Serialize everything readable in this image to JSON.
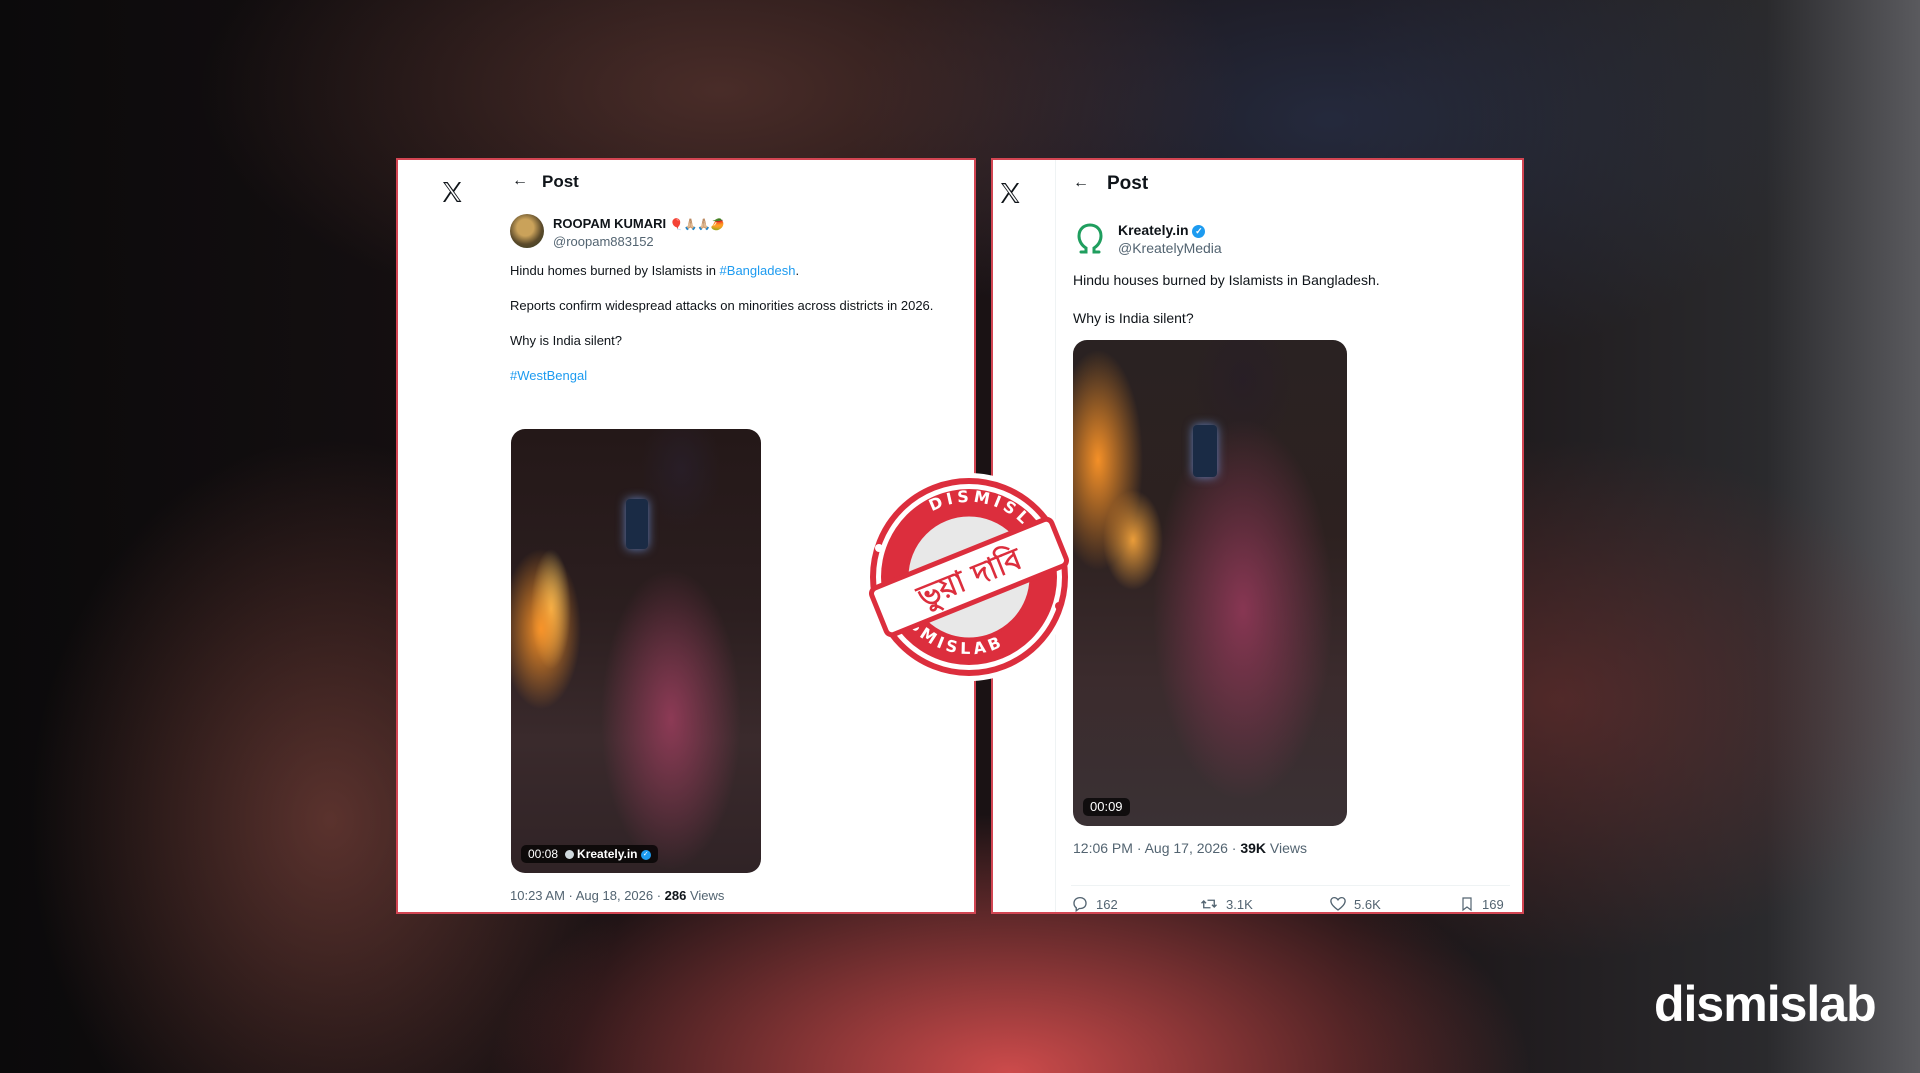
{
  "left_post": {
    "header_title": "Post",
    "author_name": "ROOPAM KUMARI",
    "author_emojis": "🎈🙏🏼🙏🏼🥭",
    "author_handle": "@roopam883152",
    "line1_prefix": "Hindu homes burned by Islamists in ",
    "line1_hashtag": "#Bangladesh",
    "line1_suffix": ".",
    "line2": "Reports confirm widespread attacks on minorities across districts in 2026.",
    "line3": "Why is India silent?",
    "hashtag2": "#WestBengal",
    "video_time": "00:08",
    "video_source": "Kreately.in",
    "timestamp": "10:23 AM · Aug 18, 2026 · ",
    "views_count": "286",
    "views_label": " Views"
  },
  "right_post": {
    "header_title": "Post",
    "author_name": "Kreately.in",
    "author_handle": "@KreatelyMedia",
    "line1": "Hindu houses burned by Islamists in Bangladesh.",
    "line2": "Why is India silent?",
    "video_time": "00:09",
    "timestamp": "12:06 PM · Aug 17, 2026 · ",
    "views_count": "39K",
    "views_label": " Views",
    "replies": "162",
    "reposts": "3.1K",
    "likes": "5.6K",
    "bookmarks": "169"
  },
  "stamp": {
    "ring_text": "DISMISLAB",
    "center_text": "ভুয়া দাবি"
  },
  "brand": "dismislab",
  "colors": {
    "accent_red": "#d24552",
    "link_blue": "#1d9bf0",
    "text_dark": "#0f1419",
    "text_muted": "#536471"
  },
  "icons": [
    "x-logo-icon",
    "back-arrow-icon",
    "verified-badge-icon",
    "reply-icon",
    "repost-icon",
    "like-icon",
    "bookmark-icon"
  ]
}
